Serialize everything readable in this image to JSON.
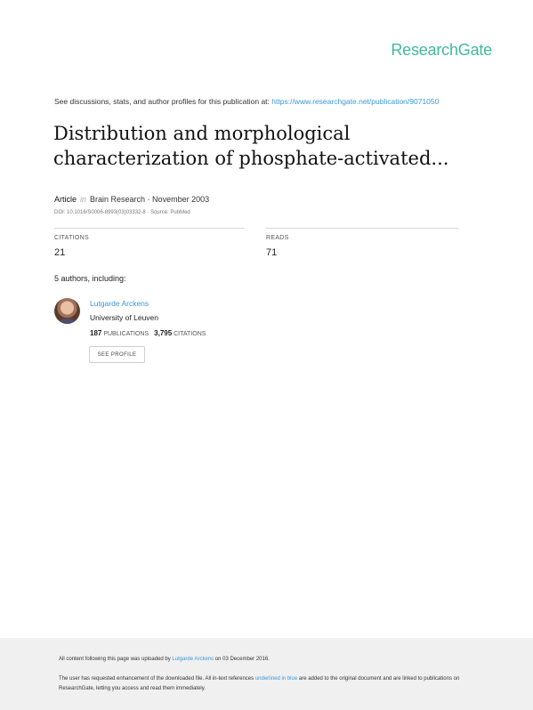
{
  "brand": {
    "logo_text": "ResearchGate",
    "color": "#40ba9b"
  },
  "header": {
    "discussion_text": "See discussions, stats, and author profiles for this publication at:",
    "url": "https://www.researchgate.net/publication/9071050"
  },
  "publication": {
    "title": "Distribution and morphological characterization of phosphate-activated...",
    "type": "Article",
    "in_word": "in",
    "journal_date": "Brain Research · November 2003",
    "doi_source": "DOI: 10.1016/S0006-8993(03)03332-8 · Source: PubMed"
  },
  "stats": {
    "citations_label": "CITATIONS",
    "citations_value": "21",
    "reads_label": "READS",
    "reads_value": "71"
  },
  "authors": {
    "heading": "5 authors, including:",
    "items": [
      {
        "name": "Lutgarde Arckens",
        "institution": "University of Leuven",
        "publications_count": "187",
        "publications_label": "PUBLICATIONS",
        "citations_count": "3,795",
        "citations_label": "CITATIONS",
        "button_label": "SEE PROFILE"
      }
    ]
  },
  "footer": {
    "uploaded_prefix": "All content following this page was uploaded by",
    "uploader": "Lutgarde Arckens",
    "uploaded_suffix": "on 03 December 2016.",
    "enhancement_prefix": "The user has requested enhancement of the downloaded file. All in-text references",
    "enhancement_link": "underlined in blue",
    "enhancement_suffix": "are added to the original document and are linked to publications on ResearchGate, letting you access and read them immediately."
  },
  "colors": {
    "link": "#3a97d4",
    "footer_bg": "#f0f0f0"
  }
}
